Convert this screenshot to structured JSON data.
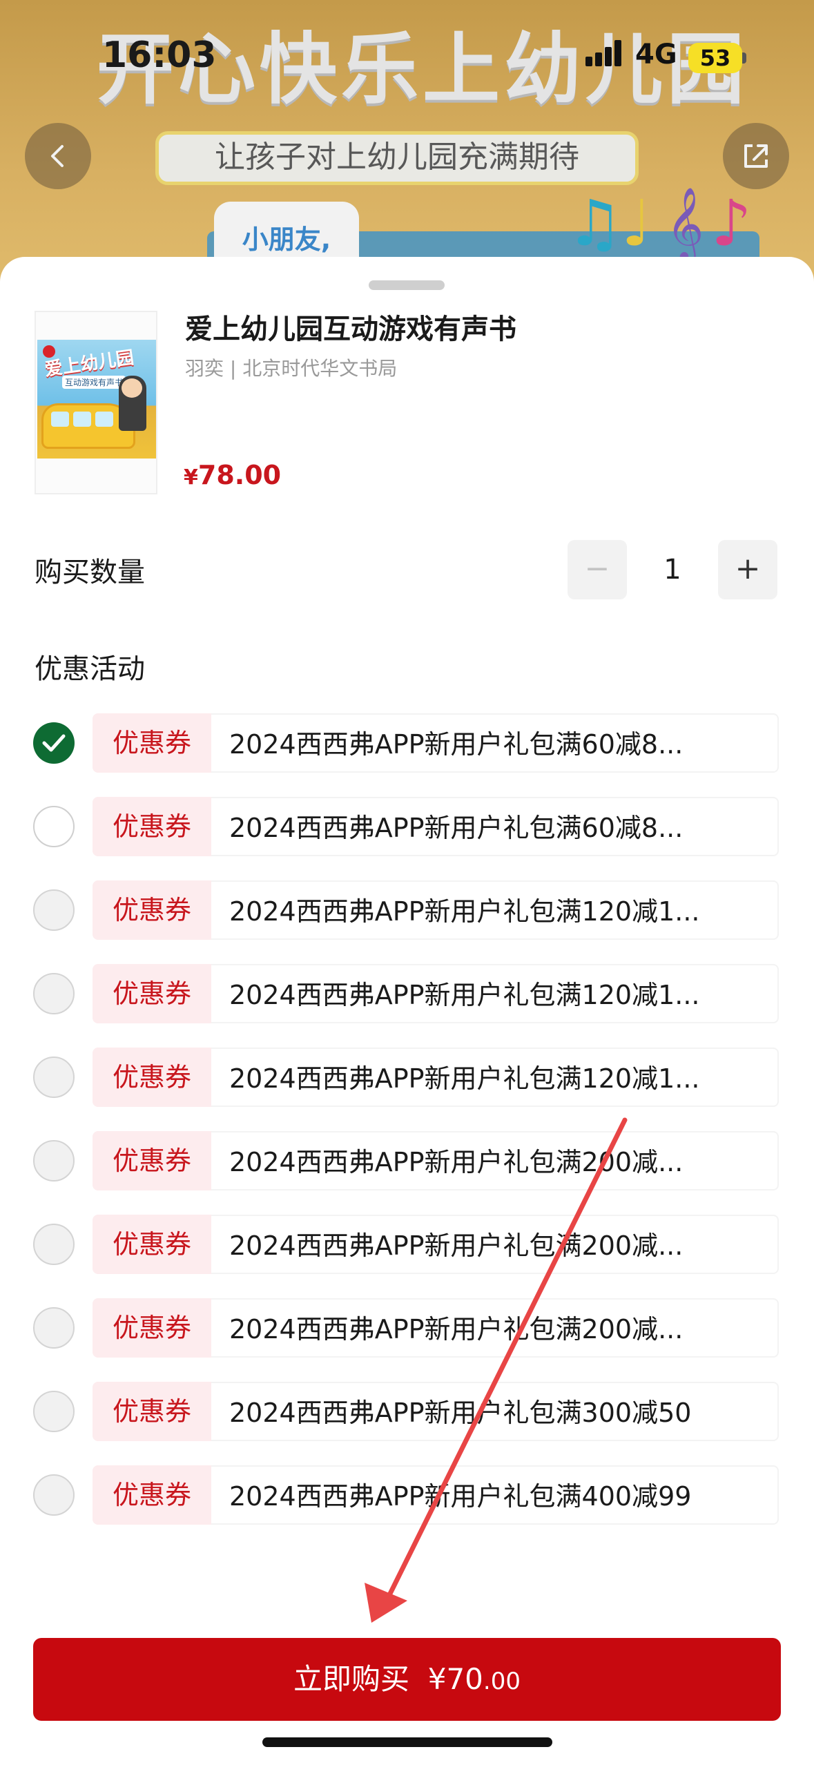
{
  "status_bar": {
    "time": "16:03",
    "network": "4G",
    "battery": "53"
  },
  "background": {
    "title": "开心快乐上幼儿园",
    "subtitle": "让孩子对上幼儿园充满期待",
    "bubble": "小朋友,"
  },
  "product": {
    "cover_title": "爱上幼儿园",
    "cover_subtitle": "互动游戏有声书",
    "title": "爱上幼儿园互动游戏有声书",
    "meta": "羽奕 | 北京时代华文书局",
    "price_symbol": "¥",
    "price": "78.00"
  },
  "quantity": {
    "label": "购买数量",
    "minus": "−",
    "value": "1",
    "plus": "+"
  },
  "promotions": {
    "label": "优惠活动",
    "coupons": [
      {
        "tag": "优惠券",
        "text": "2024西西弗APP新用户礼包满60减8...",
        "state": "checked"
      },
      {
        "tag": "优惠券",
        "text": "2024西西弗APP新用户礼包满60减8...",
        "state": "empty"
      },
      {
        "tag": "优惠券",
        "text": "2024西西弗APP新用户礼包满120减1...",
        "state": "disabled"
      },
      {
        "tag": "优惠券",
        "text": "2024西西弗APP新用户礼包满120减1...",
        "state": "disabled"
      },
      {
        "tag": "优惠券",
        "text": "2024西西弗APP新用户礼包满120减1...",
        "state": "disabled"
      },
      {
        "tag": "优惠券",
        "text": "2024西西弗APP新用户礼包满200减...",
        "state": "disabled"
      },
      {
        "tag": "优惠券",
        "text": "2024西西弗APP新用户礼包满200减...",
        "state": "disabled"
      },
      {
        "tag": "优惠券",
        "text": "2024西西弗APP新用户礼包满200减...",
        "state": "disabled"
      },
      {
        "tag": "优惠券",
        "text": "2024西西弗APP新用户礼包满300减50",
        "state": "disabled"
      },
      {
        "tag": "优惠券",
        "text": "2024西西弗APP新用户礼包满400减99",
        "state": "disabled"
      }
    ]
  },
  "buy_button": {
    "label": "立即购买",
    "price_symbol": "¥",
    "price_int": "70",
    "price_dec": ".00"
  },
  "colors": {
    "accent": "#c7090f",
    "check": "#0e6b33",
    "tag_bg": "#fdecee",
    "annotation_arrow": "#e84545"
  }
}
